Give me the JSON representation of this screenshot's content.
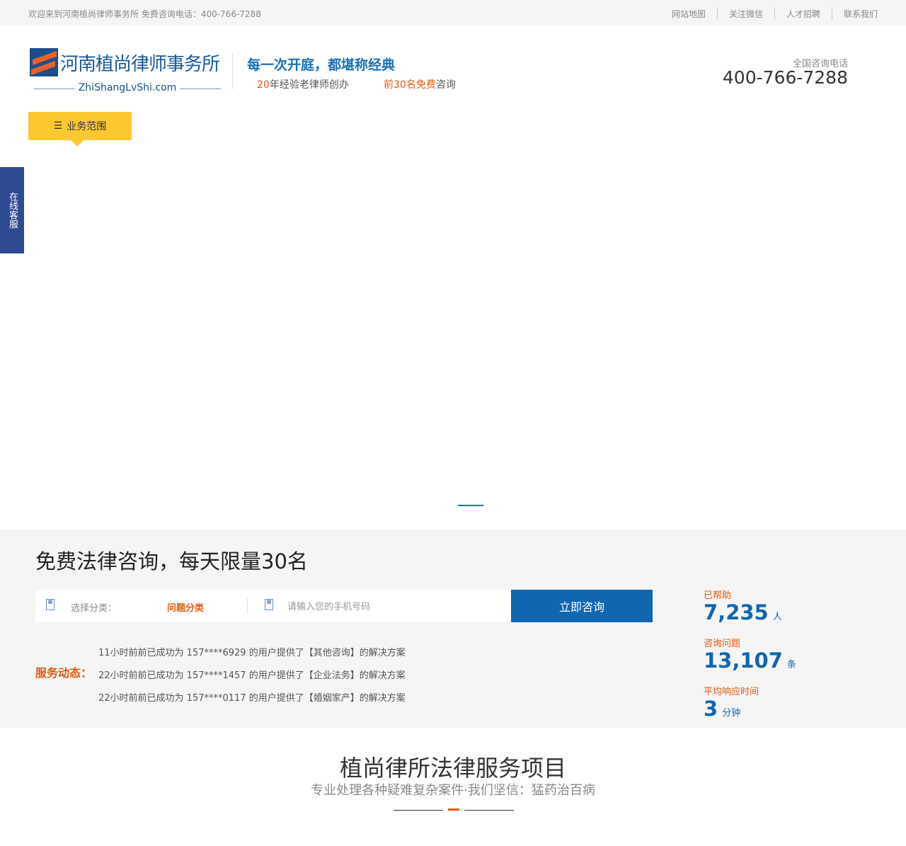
{
  "topbar": {
    "welcome": "欢迎来到河南植尚律师事务所 免费咨询电话：400-766-7288",
    "links": [
      "网站地图",
      "关注微信",
      "人才招聘",
      "联系我们"
    ]
  },
  "header": {
    "logo_name": "河南植尚律师事务所",
    "logo_url": "ZhiShangLvShi.com",
    "slogan": "每一次开庭，都堪称经典",
    "sub1_a": "20",
    "sub1_b": "年经验老律师创办",
    "sub2_a": "前30名免费",
    "sub2_b": "咨询",
    "hotline_label": "全国咨询电话",
    "hotline": "400-766-7288"
  },
  "menu": {
    "label": "业务范围"
  },
  "side": {
    "label": "在线客服"
  },
  "consult": {
    "title": "免费法律咨询，每天限量30名",
    "select_label": "选择分类：",
    "category": "问题分类",
    "phone_placeholder": "请输入您的手机号码",
    "submit": "立即咨询",
    "dyn_label": "服务动态：",
    "feed": [
      "11小时前前已成功为 157****6929 的用户提供了【其他咨询】的解决方案",
      "22小时前前已成功为 157****1457 的用户提供了【企业法务】的解决方案",
      "22小时前前已成功为 157****0117 的用户提供了【婚姻家产】的解决方案"
    ],
    "stats": [
      {
        "label": "已帮助",
        "value": "7,235",
        "unit": "人"
      },
      {
        "label": "咨询问题",
        "value": "13,107",
        "unit": "条"
      },
      {
        "label": "平均响应时间",
        "value": "3",
        "unit": "分钟"
      }
    ]
  },
  "services": {
    "title": "植尚律所法律服务项目",
    "subtitle": "专业处理各种疑难复杂案件·我们坚信：猛药治百病"
  }
}
